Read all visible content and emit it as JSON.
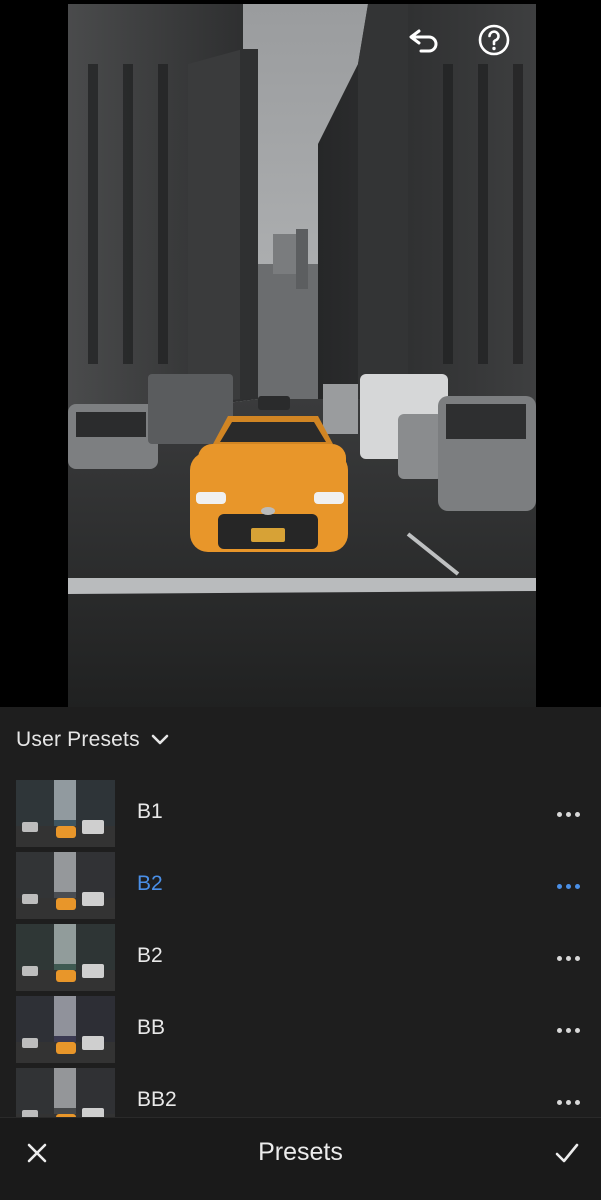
{
  "toolbar": {
    "undo_icon": "undo-icon",
    "help_icon": "help-icon"
  },
  "panel": {
    "group_label": "User Presets",
    "group_chevron_icon": "chevron-down-icon",
    "presets": [
      {
        "name": "B1",
        "selected": false
      },
      {
        "name": "B2",
        "selected": true
      },
      {
        "name": "B2",
        "selected": false
      },
      {
        "name": "BB",
        "selected": false
      },
      {
        "name": "BB2",
        "selected": false
      }
    ]
  },
  "bottom_bar": {
    "title": "Presets",
    "close_icon": "close-icon",
    "confirm_icon": "checkmark-icon"
  },
  "colors": {
    "accent": "#4a8fe7",
    "panel_bg": "#1e1e1e",
    "bar_bg": "#1a1a1a",
    "text": "#e8e8e8",
    "taxi": "#e8962a"
  }
}
